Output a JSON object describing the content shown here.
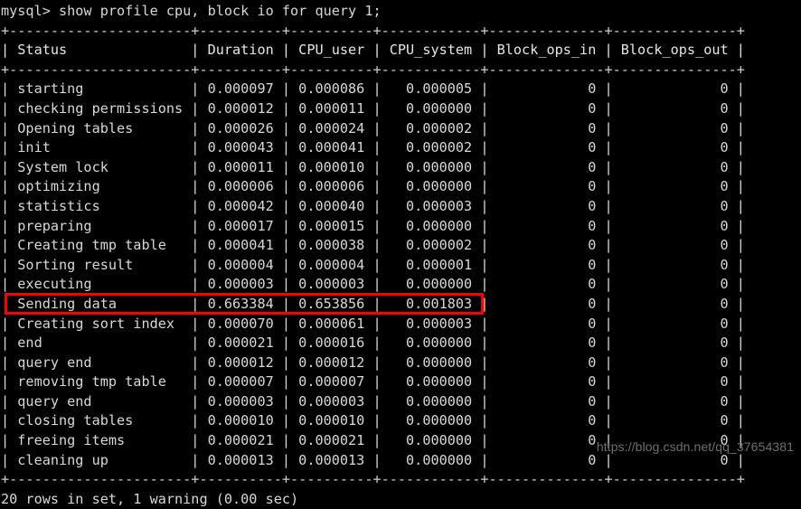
{
  "terminal": {
    "prompt": "mysql> show profile cpu, block io for query 1;",
    "separator": "+----------------------+----------+----------+------------+--------------+---------------+",
    "footer": "20 rows in set, 1 warning (0.00 sec)",
    "watermark": "https://blog.csdn.net/qq_37654381",
    "highlight_color": "#fb0000",
    "highlighted_row_status": "Sending data"
  },
  "table": {
    "columns": [
      "Status",
      "Duration",
      "CPU_user",
      "CPU_system",
      "Block_ops_in",
      "Block_ops_out"
    ],
    "header_line": "| Status               | Duration | CPU_user | CPU_system | Block_ops_in | Block_ops_out |",
    "rows": [
      {
        "status": "starting",
        "duration": "0.000097",
        "cpu_user": "0.000086",
        "cpu_system": "0.000005",
        "block_ops_in": "0",
        "block_ops_out": "0"
      },
      {
        "status": "checking permissions",
        "duration": "0.000012",
        "cpu_user": "0.000011",
        "cpu_system": "0.000000",
        "block_ops_in": "0",
        "block_ops_out": "0"
      },
      {
        "status": "Opening tables",
        "duration": "0.000026",
        "cpu_user": "0.000024",
        "cpu_system": "0.000002",
        "block_ops_in": "0",
        "block_ops_out": "0"
      },
      {
        "status": "init",
        "duration": "0.000043",
        "cpu_user": "0.000041",
        "cpu_system": "0.000002",
        "block_ops_in": "0",
        "block_ops_out": "0"
      },
      {
        "status": "System lock",
        "duration": "0.000011",
        "cpu_user": "0.000010",
        "cpu_system": "0.000000",
        "block_ops_in": "0",
        "block_ops_out": "0"
      },
      {
        "status": "optimizing",
        "duration": "0.000006",
        "cpu_user": "0.000006",
        "cpu_system": "0.000000",
        "block_ops_in": "0",
        "block_ops_out": "0"
      },
      {
        "status": "statistics",
        "duration": "0.000042",
        "cpu_user": "0.000040",
        "cpu_system": "0.000003",
        "block_ops_in": "0",
        "block_ops_out": "0"
      },
      {
        "status": "preparing",
        "duration": "0.000017",
        "cpu_user": "0.000015",
        "cpu_system": "0.000000",
        "block_ops_in": "0",
        "block_ops_out": "0"
      },
      {
        "status": "Creating tmp table",
        "duration": "0.000041",
        "cpu_user": "0.000038",
        "cpu_system": "0.000002",
        "block_ops_in": "0",
        "block_ops_out": "0"
      },
      {
        "status": "Sorting result",
        "duration": "0.000004",
        "cpu_user": "0.000004",
        "cpu_system": "0.000001",
        "block_ops_in": "0",
        "block_ops_out": "0"
      },
      {
        "status": "executing",
        "duration": "0.000003",
        "cpu_user": "0.000003",
        "cpu_system": "0.000000",
        "block_ops_in": "0",
        "block_ops_out": "0"
      },
      {
        "status": "Sending data",
        "duration": "0.663384",
        "cpu_user": "0.653856",
        "cpu_system": "0.001803",
        "block_ops_in": "0",
        "block_ops_out": "0"
      },
      {
        "status": "Creating sort index",
        "duration": "0.000070",
        "cpu_user": "0.000061",
        "cpu_system": "0.000003",
        "block_ops_in": "0",
        "block_ops_out": "0"
      },
      {
        "status": "end",
        "duration": "0.000021",
        "cpu_user": "0.000016",
        "cpu_system": "0.000000",
        "block_ops_in": "0",
        "block_ops_out": "0"
      },
      {
        "status": "query end",
        "duration": "0.000012",
        "cpu_user": "0.000012",
        "cpu_system": "0.000000",
        "block_ops_in": "0",
        "block_ops_out": "0"
      },
      {
        "status": "removing tmp table",
        "duration": "0.000007",
        "cpu_user": "0.000007",
        "cpu_system": "0.000000",
        "block_ops_in": "0",
        "block_ops_out": "0"
      },
      {
        "status": "query end",
        "duration": "0.000003",
        "cpu_user": "0.000003",
        "cpu_system": "0.000000",
        "block_ops_in": "0",
        "block_ops_out": "0"
      },
      {
        "status": "closing tables",
        "duration": "0.000010",
        "cpu_user": "0.000010",
        "cpu_system": "0.000000",
        "block_ops_in": "0",
        "block_ops_out": "0"
      },
      {
        "status": "freeing items",
        "duration": "0.000021",
        "cpu_user": "0.000021",
        "cpu_system": "0.000000",
        "block_ops_in": "0",
        "block_ops_out": "0"
      },
      {
        "status": "cleaning up",
        "duration": "0.000013",
        "cpu_user": "0.000013",
        "cpu_system": "0.000000",
        "block_ops_in": "0",
        "block_ops_out": "0"
      }
    ]
  }
}
